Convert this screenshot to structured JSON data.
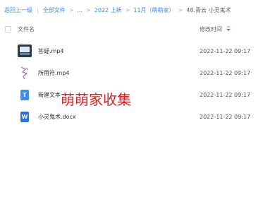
{
  "breadcrumb": {
    "back": "返回上一级",
    "all_files": "全部文件",
    "ellipsis": "...",
    "folder1": "2022 上新",
    "folder2": "11月（萌萌家）",
    "current": "48.青云 小灵鬼术"
  },
  "header": {
    "name_col": "文件名",
    "time_col": "修改时间"
  },
  "files": [
    {
      "name": "答疑.mp4",
      "time": "2022-11-22 09:17",
      "icon": "video-thumbnail-icon"
    },
    {
      "name": "所用符.mp4",
      "time": "2022-11-22 09:17",
      "icon": "talisman-sketch-icon"
    },
    {
      "name": "新建文本",
      "time": "2022-11-22 09:17",
      "icon": "txt-file-icon"
    },
    {
      "name": "小灵鬼术.docx",
      "time": "2022-11-22 09:17",
      "icon": "word-file-icon"
    }
  ],
  "icons": {
    "txt_letter": "T",
    "word_letter": "W"
  },
  "watermark": "萌萌家收集",
  "colors": {
    "link": "#3b8cf3",
    "watermark": "#e02020"
  }
}
